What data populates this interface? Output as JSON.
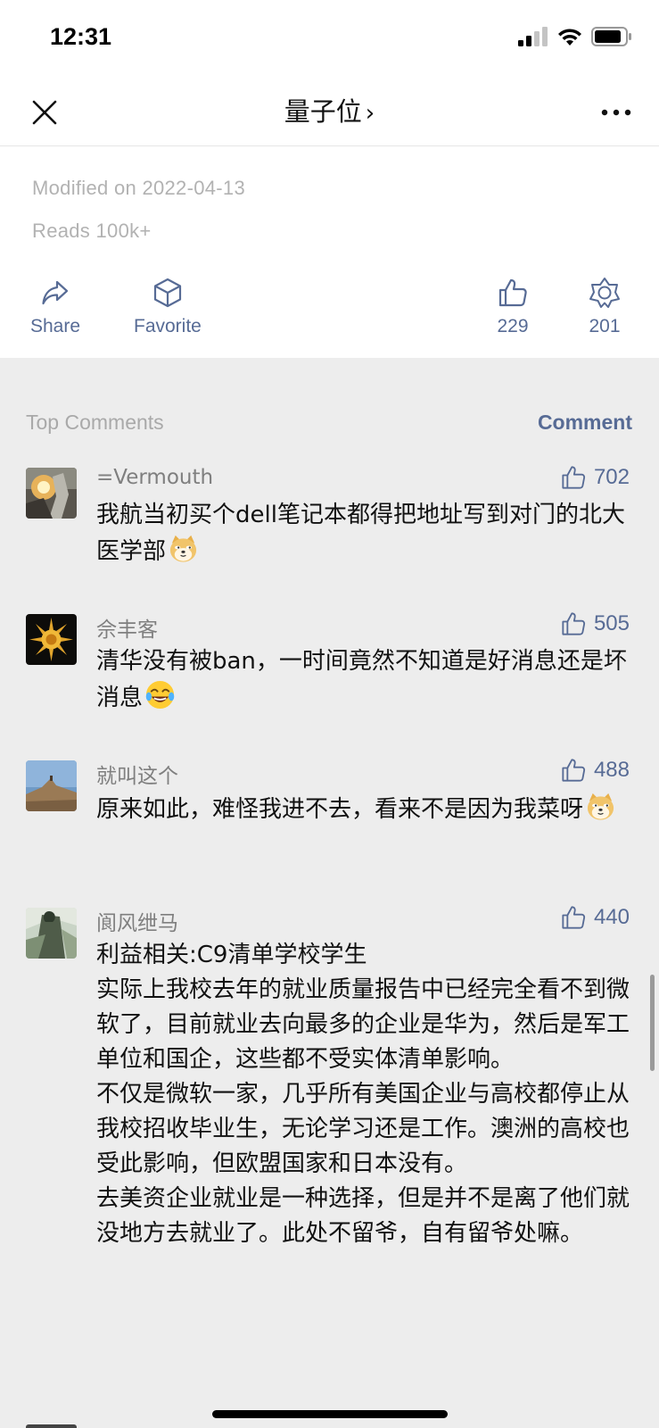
{
  "status_bar": {
    "time": "12:31"
  },
  "nav": {
    "title": "量子位",
    "chevron": "›"
  },
  "meta": {
    "modified": "Modified on 2022-04-13",
    "reads": "Reads 100k+"
  },
  "actions": {
    "share_label": "Share",
    "favorite_label": "Favorite",
    "like_count": "229",
    "wow_count": "201"
  },
  "comments_section": {
    "title": "Top Comments",
    "comment_link": "Comment"
  },
  "comments": [
    {
      "name": "=Vermouth",
      "likes": "702",
      "text": "我航当初买个dell笔记本都得把地址写到对门的北大医学部"
    },
    {
      "name": "佘丰客",
      "likes": "505",
      "text": "清华没有被ban，一时间竟然不知道是好消息还是坏消息"
    },
    {
      "name": "就叫这个",
      "likes": "488",
      "text": "原来如此，难怪我进不去，看来不是因为我菜呀"
    },
    {
      "name": "阆风绁马",
      "likes": "440",
      "text": "利益相关:C9清单学校学生\n实际上我校去年的就业质量报告中已经完全看不到微软了，目前就业去向最多的企业是华为，然后是军工单位和国企，这些都不受实体清单影响。\n不仅是微软一家，几乎所有美国企业与高校都停止从我校招收毕业生，无论学习还是工作。澳洲的高校也受此影响，但欧盟国家和日本没有。\n去美资企业就业是一种选择，但是并不是离了他们就没地方去就业了。此处不留爷，自有留爷处嘛。"
    }
  ],
  "colors": {
    "link": "#576b95",
    "muted": "#b2b2b2",
    "background": "#ededed"
  }
}
